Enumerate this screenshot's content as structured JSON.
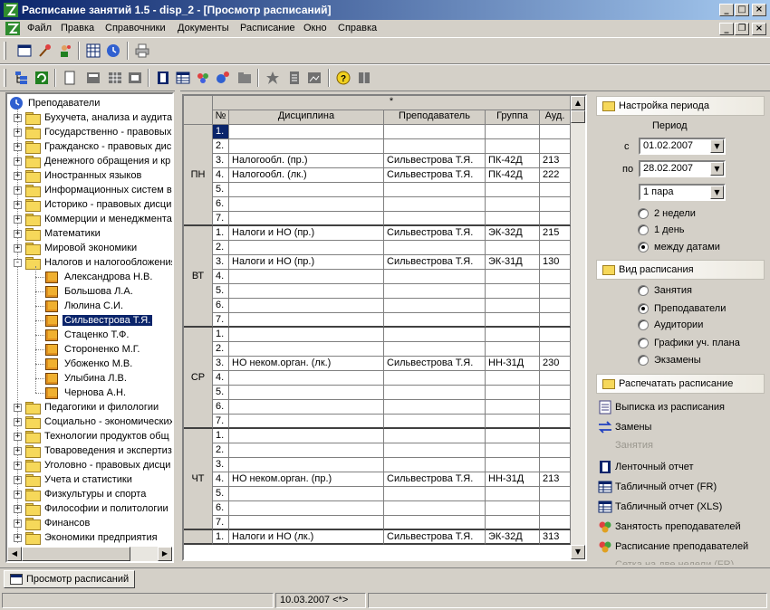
{
  "window": {
    "title": "Расписание занятий 1.5 - disp_2 - [Просмотр расписаний]"
  },
  "menu": [
    "Файл",
    "Правка",
    "Справочники",
    "Документы",
    "Расписание",
    "Окно",
    "Справка"
  ],
  "tree": {
    "root": "Преподаватели",
    "items": [
      {
        "label": "Бухучета, анализа и аудита",
        "expander": "+"
      },
      {
        "label": "Государственно - правовых",
        "expander": "+"
      },
      {
        "label": "Гражданско - правовых дисц",
        "expander": "+"
      },
      {
        "label": "Денежного обращения и кр",
        "expander": "+"
      },
      {
        "label": "Иностранных языков",
        "expander": "+"
      },
      {
        "label": "Информационных систем в э",
        "expander": "+"
      },
      {
        "label": "Историко - правовых дисци",
        "expander": "+"
      },
      {
        "label": "Коммерции и менеджмента",
        "expander": "+"
      },
      {
        "label": "Математики",
        "expander": "+"
      },
      {
        "label": "Мировой экономики",
        "expander": "+"
      },
      {
        "label": "Налогов и налогообложения",
        "expander": "-"
      }
    ],
    "children": [
      "Александрова Н.В.",
      "Большова Л.А.",
      "Люлина С.И.",
      "Сильвестрова Т.Я.",
      "Стаценко Т.Ф.",
      "Стороненко М.Г.",
      "Убоженко М.В.",
      "Улыбина Л.В.",
      "Чернова А.Н."
    ],
    "selected_child": "Сильвестрова Т.Я.",
    "items_after": [
      {
        "label": "Педагогики и филологии",
        "expander": "+"
      },
      {
        "label": "Социально - экономических",
        "expander": "+"
      },
      {
        "label": "Технологии продуктов общ",
        "expander": "+"
      },
      {
        "label": "Товароведения и экспертиз",
        "expander": "+"
      },
      {
        "label": "Уголовно - правовых дисци",
        "expander": "+"
      },
      {
        "label": "Учета и статистики",
        "expander": "+"
      },
      {
        "label": "Физкультуры и спорта",
        "expander": "+"
      },
      {
        "label": "Философии и политологии",
        "expander": "+"
      },
      {
        "label": "Финансов",
        "expander": "+"
      },
      {
        "label": "Экономики предприятия",
        "expander": "+"
      }
    ]
  },
  "grid": {
    "star_header": "*",
    "columns": [
      "№",
      "Дисциплина",
      "Преподаватель",
      "Группа",
      "Ауд."
    ],
    "days": [
      {
        "day": "ПН",
        "rows": [
          [
            "1.",
            "",
            "",
            "",
            ""
          ],
          [
            "2.",
            "",
            "",
            "",
            ""
          ],
          [
            "3.",
            "Налогообл. (пр.)",
            "Сильвестрова Т.Я.",
            "ПК-42Д",
            "213"
          ],
          [
            "4.",
            "Налогообл. (лк.)",
            "Сильвестрова Т.Я.",
            "ПК-42Д",
            "222"
          ],
          [
            "5.",
            "",
            "",
            "",
            ""
          ],
          [
            "6.",
            "",
            "",
            "",
            ""
          ],
          [
            "7.",
            "",
            "",
            "",
            ""
          ]
        ]
      },
      {
        "day": "ВТ",
        "rows": [
          [
            "1.",
            "Налоги и НО (пр.)",
            "Сильвестрова Т.Я.",
            "ЭК-32Д",
            "215"
          ],
          [
            "2.",
            "",
            "",
            "",
            ""
          ],
          [
            "3.",
            "Налоги и НО (пр.)",
            "Сильвестрова Т.Я.",
            "ЭК-31Д",
            "130"
          ],
          [
            "4.",
            "",
            "",
            "",
            ""
          ],
          [
            "5.",
            "",
            "",
            "",
            ""
          ],
          [
            "6.",
            "",
            "",
            "",
            ""
          ],
          [
            "7.",
            "",
            "",
            "",
            ""
          ]
        ]
      },
      {
        "day": "СР",
        "rows": [
          [
            "1.",
            "",
            "",
            "",
            ""
          ],
          [
            "2.",
            "",
            "",
            "",
            ""
          ],
          [
            "3.",
            "НО неком.орган. (лк.)",
            "Сильвестрова Т.Я.",
            "НН-31Д",
            "230"
          ],
          [
            "4.",
            "",
            "",
            "",
            ""
          ],
          [
            "5.",
            "",
            "",
            "",
            ""
          ],
          [
            "6.",
            "",
            "",
            "",
            ""
          ],
          [
            "7.",
            "",
            "",
            "",
            ""
          ]
        ]
      },
      {
        "day": "ЧТ",
        "rows": [
          [
            "1.",
            "",
            "",
            "",
            ""
          ],
          [
            "2.",
            "",
            "",
            "",
            ""
          ],
          [
            "3.",
            "",
            "",
            "",
            ""
          ],
          [
            "4.",
            "НО неком.орган. (пр.)",
            "Сильвестрова Т.Я.",
            "НН-31Д",
            "213"
          ],
          [
            "5.",
            "",
            "",
            "",
            ""
          ],
          [
            "6.",
            "",
            "",
            "",
            ""
          ],
          [
            "7.",
            "",
            "",
            "",
            ""
          ]
        ]
      },
      {
        "day": "",
        "rows": [
          [
            "1.",
            "Налоги и НО (лк.)",
            "Сильвестрова Т.Я.",
            "ЭК-32Д",
            "313"
          ]
        ]
      }
    ]
  },
  "period": {
    "header": "Настройка периода",
    "label": "Период",
    "from_label": "с",
    "from_value": "01.02.2007",
    "to_label": "по",
    "to_value": "28.02.2007",
    "pair_value": "1 пара",
    "options": [
      "2 недели",
      "1 день",
      "между датами"
    ],
    "selected": 2
  },
  "view": {
    "header": "Вид расписания",
    "options": [
      "Занятия",
      "Преподаватели",
      "Аудитории",
      "Графики уч. плана",
      "Экзамены"
    ],
    "selected": 1
  },
  "print": {
    "header": "Распечатать расписание",
    "links": [
      {
        "label": "Выписка из расписания",
        "icon": "document-icon",
        "enabled": true
      },
      {
        "label": "Замены",
        "icon": "swap-arrows-icon",
        "enabled": true
      },
      {
        "label": "Занятия",
        "icon": "",
        "enabled": false
      },
      {
        "label": "Ленточный отчет",
        "icon": "film-icon",
        "enabled": true
      },
      {
        "label": "Табличный отчет (FR)",
        "icon": "table-icon",
        "enabled": true
      },
      {
        "label": "Табличный отчет (XLS)",
        "icon": "table-icon",
        "enabled": true
      },
      {
        "label": "Занятость преподавателей",
        "icon": "people-icon",
        "enabled": true
      },
      {
        "label": "Расписание преподавателей",
        "icon": "people-icon",
        "enabled": true
      },
      {
        "label": "Сетка на две недели (FR)",
        "icon": "",
        "enabled": false
      }
    ]
  },
  "tabs": [
    "Просмотр расписаний"
  ],
  "status": {
    "date": "10.03.2007 <*>"
  }
}
